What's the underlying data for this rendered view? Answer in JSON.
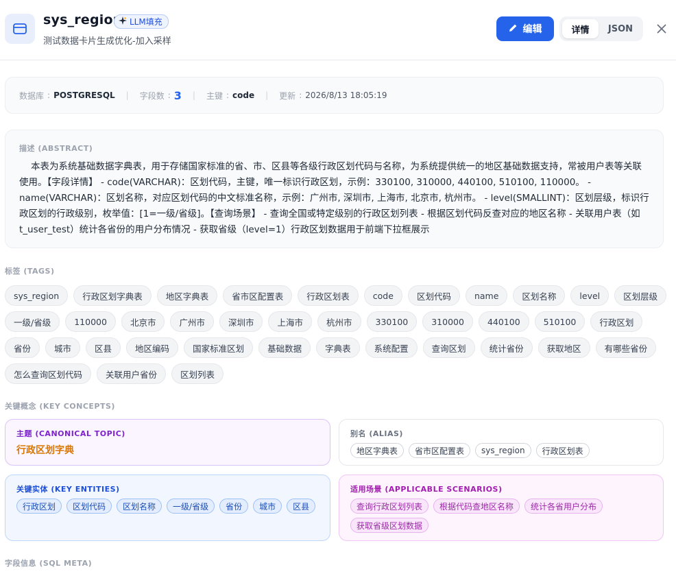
{
  "header": {
    "title": "sys_region",
    "badge": "LLM填充",
    "subtitle": "测试数据卡片生成优化-加入采样",
    "edit_label": "编辑",
    "tabs": [
      "详情",
      "JSON"
    ],
    "active_tab": "详情"
  },
  "meta": {
    "db_label": "数据库",
    "db_value": "POSTGRESQL",
    "fields_label": "字段数",
    "fields_value": "3",
    "pk_label": "主键",
    "pk_value": "code",
    "updated_label": "更新",
    "updated_value": "2026/8/13 18:05:19"
  },
  "description": {
    "label": "描述 (ABSTRACT)",
    "text": "本表为系统基础数据字典表，用于存储国家标准的省、市、区县等各级行政区划代码与名称，为系统提供统一的地区基础数据支持，常被用户表等关联使用。【字段详情】 - code(VARCHAR)：区划代码，主键，唯一标识行政区划，示例：330100, 310000, 440100, 510100, 110000。 - name(VARCHAR)：区划名称，对应区划代码的中文标准名称，示例：广州市, 深圳市, 上海市, 北京市, 杭州市。 - level(SMALLINT)：区划层级，标识行政区划的行政级别，枚举值：[1=一级/省级]。【查询场景】 - 查询全国或特定级别的行政区划列表 - 根据区划代码反查对应的地区名称 - 关联用户表（如t_user_test）统计各省份的用户分布情况 - 获取省级（level=1）行政区划数据用于前端下拉框展示"
  },
  "tags": {
    "label": "标签 (TAGS)",
    "items": [
      "sys_region",
      "行政区划字典表",
      "地区字典表",
      "省市区配置表",
      "行政区划表",
      "code",
      "区划代码",
      "name",
      "区划名称",
      "level",
      "区划层级",
      "一级/省级",
      "110000",
      "北京市",
      "广州市",
      "深圳市",
      "上海市",
      "杭州市",
      "330100",
      "310000",
      "440100",
      "510100",
      "行政区划",
      "省份",
      "城市",
      "区县",
      "地区编码",
      "国家标准区划",
      "基础数据",
      "字典表",
      "系统配置",
      "查询区划",
      "统计省份",
      "获取地区",
      "有哪些省份",
      "怎么查询区划代码",
      "关联用户省份",
      "区划列表"
    ]
  },
  "concepts": {
    "label": "关键概念 (KEY CONCEPTS)",
    "topic_title": "主题 (CANONICAL TOPIC)",
    "topic_value": "行政区划字典",
    "alias_title": "别名 (ALIAS)",
    "aliases": [
      "地区字典表",
      "省市区配置表",
      "sys_region",
      "行政区划表"
    ],
    "entities_title": "关键实体 (KEY ENTITIES)",
    "entities": [
      "行政区划",
      "区划代码",
      "区划名称",
      "一级/省级",
      "省份",
      "城市",
      "区县"
    ],
    "scenarios_title": "适用场景 (APPLICABLE SCENARIOS)",
    "scenarios": [
      "查询行政区划列表",
      "根据代码查地区名称",
      "统计各省用户分布",
      "获取省级区划数据"
    ]
  },
  "sql_meta": {
    "label": "字段信息 (SQL META)"
  },
  "colors": {
    "primary": "#2563eb",
    "topic": "#d97706",
    "entity_border": "#9cc0f6",
    "scenario_border": "#e6b3ee"
  },
  "icons": [
    "table-icon",
    "sparkle-icon",
    "pencil-icon",
    "close-icon"
  ]
}
